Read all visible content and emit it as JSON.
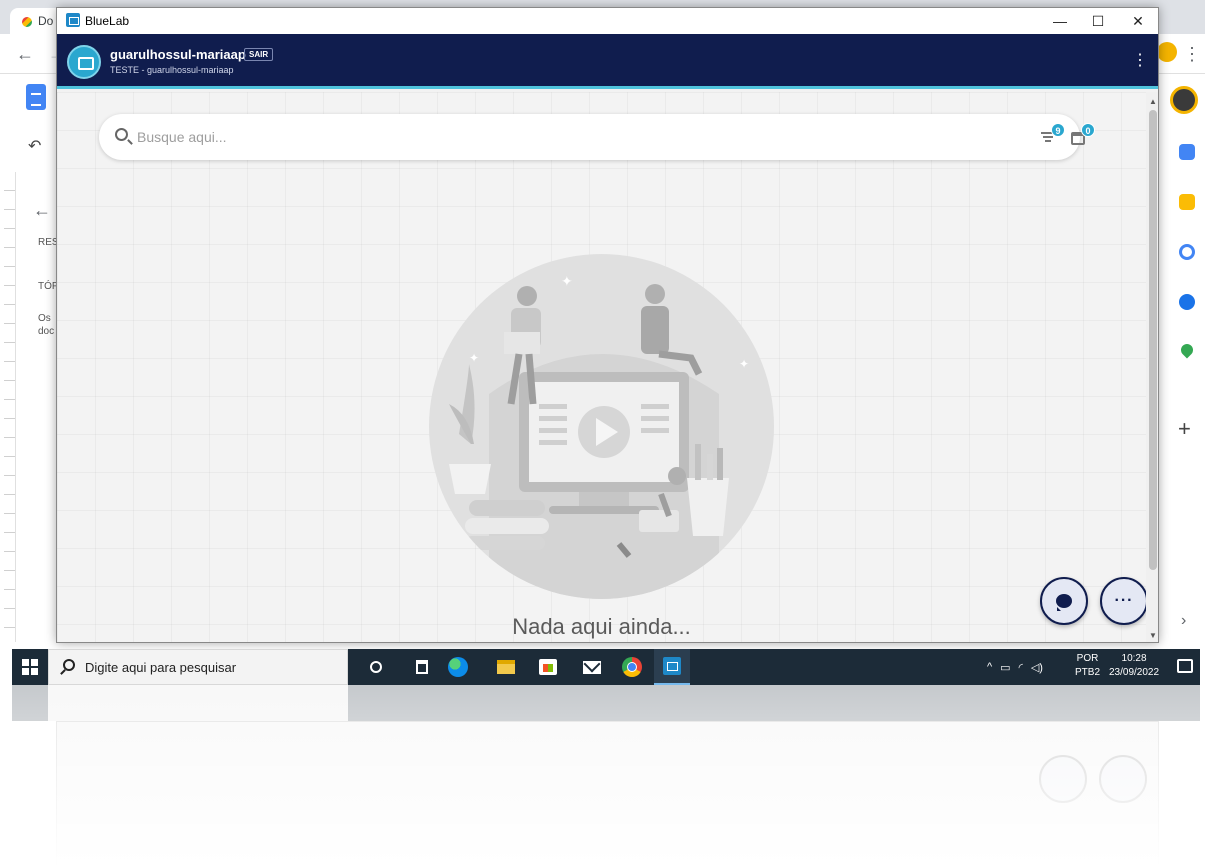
{
  "browser": {
    "tab_title": "Do",
    "docs_labels": [
      "RES",
      "TÓP",
      "Os",
      "doc"
    ]
  },
  "window": {
    "title": "BlueLab",
    "controls": [
      "—",
      "☐",
      "✕"
    ]
  },
  "header": {
    "username": "guarulhossul-mariaap",
    "logout_label": "SAIR",
    "subtitle": "TESTE - guarulhossul-mariaap",
    "menu_icon": "⋮",
    "colors": {
      "bar": "#101d4e",
      "accent": "#4fc3dc"
    }
  },
  "search": {
    "placeholder": "Busque aqui...",
    "filter_badge": "9",
    "calendar_badge": "0"
  },
  "empty_state": {
    "message": "Nada aqui ainda..."
  },
  "fabs": {
    "chat_icon": "chat-bubble-icon",
    "more_label": "···"
  },
  "taskbar": {
    "search_placeholder": "Digite aqui para pesquisar",
    "apps": [
      "cortana",
      "task-view",
      "edge",
      "file-explorer",
      "store",
      "mail",
      "chrome",
      "bluelab"
    ],
    "tray_arrow": "^",
    "language": "POR",
    "keyboard": "PTB2",
    "time": "10:28",
    "date": "23/09/2022"
  },
  "sidebar_right": {
    "add_label": "+",
    "chevron": "›"
  }
}
